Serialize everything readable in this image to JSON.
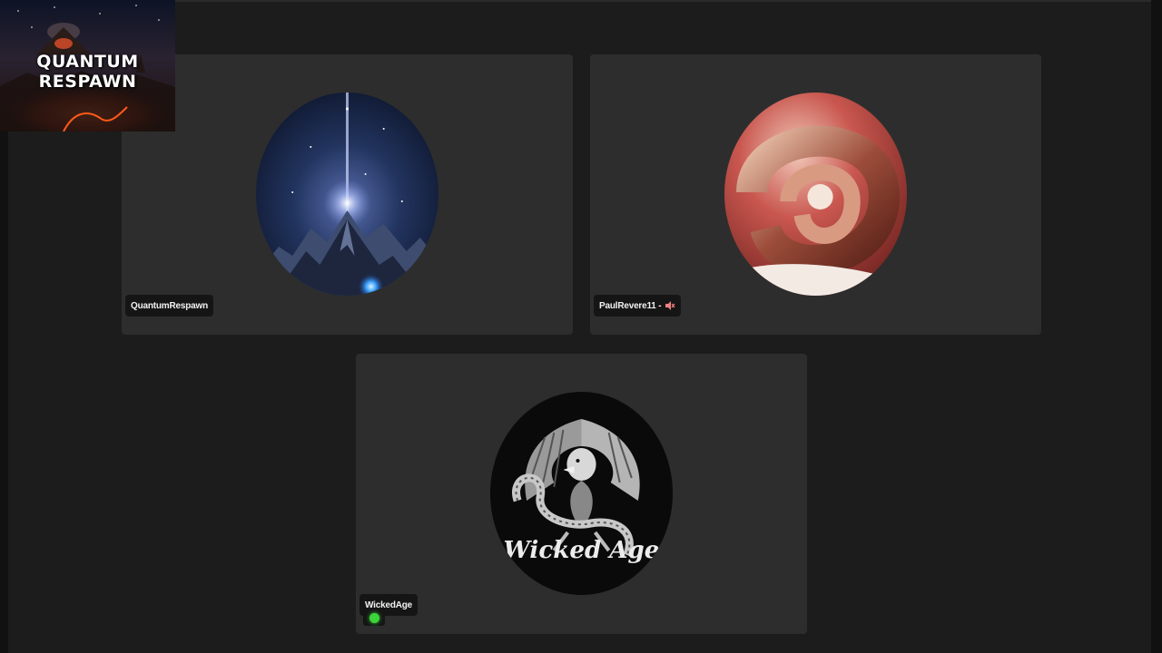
{
  "logo": {
    "text": "QUANTUM RESPAWN"
  },
  "participants": [
    {
      "name": "QuantumRespawn",
      "muted": false,
      "speaking": false,
      "avatar": "night-mountain-star-avatar"
    },
    {
      "name": "PaulRevere11 -",
      "muted": true,
      "speaking": false,
      "avatar": "abstract-swirl-avatar"
    },
    {
      "name": "WickedAge",
      "muted": false,
      "speaking": true,
      "avatar": "eagle-serpent-avatar"
    }
  ],
  "colors": {
    "background": "#1c1c1c",
    "tile": "#2d2d2d",
    "name_tag": "#151515",
    "speaking": "#3bd43b",
    "muted_icon": "#f08080"
  }
}
